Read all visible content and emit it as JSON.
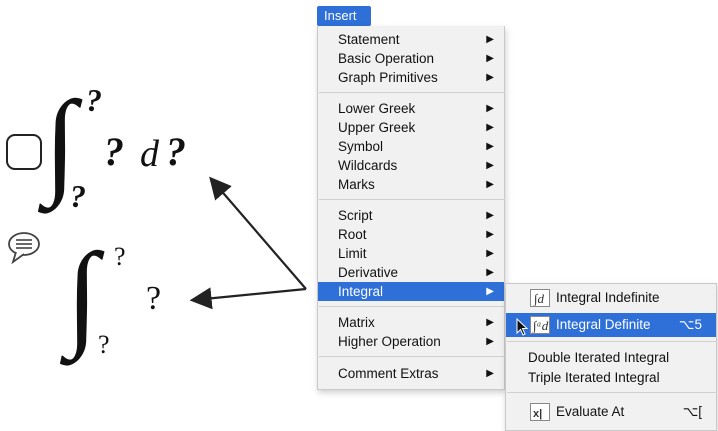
{
  "menubar": {
    "insert_label": "Insert"
  },
  "insert_menu": {
    "groups": [
      [
        {
          "label": "Statement",
          "submenu": true
        },
        {
          "label": "Basic Operation",
          "submenu": true
        },
        {
          "label": "Graph Primitives",
          "submenu": true
        }
      ],
      [
        {
          "label": "Lower Greek",
          "submenu": true
        },
        {
          "label": "Upper Greek",
          "submenu": true
        },
        {
          "label": "Symbol",
          "submenu": true
        },
        {
          "label": "Wildcards",
          "submenu": true
        },
        {
          "label": "Marks",
          "submenu": true
        }
      ],
      [
        {
          "label": "Script",
          "submenu": true
        },
        {
          "label": "Root",
          "submenu": true
        },
        {
          "label": "Limit",
          "submenu": true
        },
        {
          "label": "Derivative",
          "submenu": true
        },
        {
          "label": "Integral",
          "submenu": true,
          "selected": true
        }
      ],
      [
        {
          "label": "Matrix",
          "submenu": true
        },
        {
          "label": "Higher Operation",
          "submenu": true
        }
      ],
      [
        {
          "label": "Comment Extras",
          "submenu": true
        }
      ]
    ],
    "arrow_glyph": "▶"
  },
  "integral_submenu": {
    "items": [
      {
        "label": "Integral Indefinite",
        "icon": "integral-indefinite-icon",
        "shortcut": ""
      },
      {
        "label": "Integral Definite",
        "icon": "integral-definite-icon",
        "shortcut": "⌥5",
        "selected": true
      },
      {
        "label": "Double Iterated Integral",
        "icon": "",
        "shortcut": ""
      },
      {
        "label": "Triple Iterated Integral",
        "icon": "",
        "shortcut": ""
      },
      {
        "label": "Evaluate At",
        "icon": "evaluate-at-icon",
        "shortcut": "⌥["
      }
    ]
  },
  "illustration": {
    "integral_symbol": "∫",
    "placeholder": "?",
    "differential": "d",
    "icons": [
      "checkbox-icon",
      "comment-bubble-icon"
    ],
    "colors": {
      "accent": "#2e6fd8",
      "menu_bg": "#f1f1f1"
    }
  }
}
